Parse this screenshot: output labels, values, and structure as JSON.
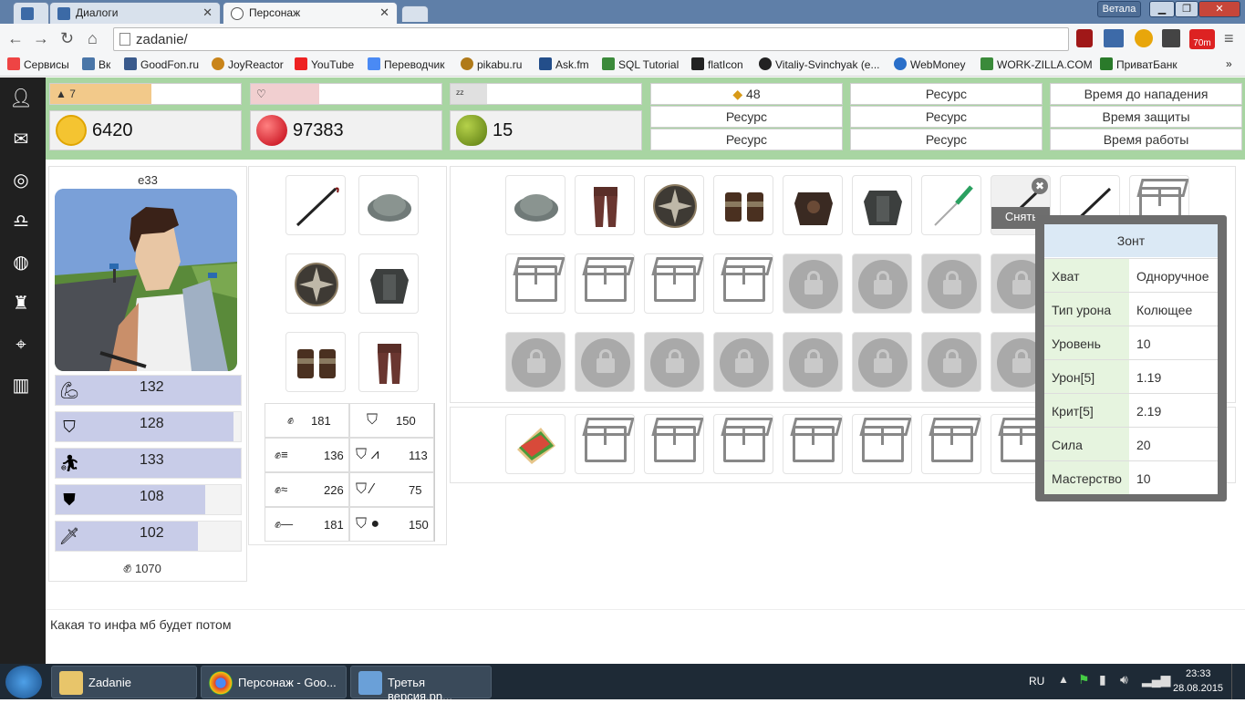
{
  "browser": {
    "tabs": [
      {
        "label": ""
      },
      {
        "label": "Диалоги"
      },
      {
        "label": "Персонаж"
      }
    ],
    "user_badge": "Ветала",
    "url": "zadanie/",
    "bookmarks": [
      "Сервисы",
      "Вк",
      "GoodFon.ru",
      "JoyReactor",
      "YouTube",
      "Переводчик",
      "pikabu.ru",
      "Ask.fm",
      "SQL Tutorial",
      "flatIcon",
      "Vitaliy-Svinchyak (e...",
      "WebMoney",
      "WORK-ZILLA.COM",
      "ПриватБанк"
    ],
    "ext_badge": "70m"
  },
  "status": {
    "level": "7",
    "level_pct": 0.53,
    "health_pct": 0.36,
    "sleep_pct": 0.19,
    "gold": "6420",
    "rubies": "97383",
    "olives": "15"
  },
  "resources": {
    "col1": [
      "48",
      "Ресурс",
      "Ресурс"
    ],
    "col2": [
      "Ресурс",
      "Ресурс",
      "Ресурс"
    ],
    "col3": [
      "Время до нападения",
      "Время защиты",
      "Время работы"
    ]
  },
  "character": {
    "name": "e33",
    "stats": [
      {
        "icon": "strength-icon",
        "value": "132",
        "pct": 1.0
      },
      {
        "icon": "defense-icon",
        "value": "128",
        "pct": 0.96
      },
      {
        "icon": "agility-icon",
        "value": "133",
        "pct": 1.0
      },
      {
        "icon": "armor-icon",
        "value": "108",
        "pct": 0.81
      },
      {
        "icon": "sword-icon",
        "value": "102",
        "pct": 0.77
      }
    ],
    "power": "1070"
  },
  "combat": {
    "attack": [
      "181",
      "136",
      "226",
      "181"
    ],
    "defense": [
      "150",
      "113",
      "75",
      "150"
    ]
  },
  "tooltip": {
    "title": "Зонт",
    "unequip": "Снять",
    "rows": [
      {
        "k": "Хват",
        "v": "Одноручное"
      },
      {
        "k": "Тип урона",
        "v": "Колющее"
      },
      {
        "k": "Уровень",
        "v": "10"
      },
      {
        "k": "Урон[5]",
        "v": "1.19"
      },
      {
        "k": "Крит[5]",
        "v": "2.19"
      },
      {
        "k": "Сила",
        "v": "20"
      },
      {
        "k": "Мастерство",
        "v": "10"
      }
    ]
  },
  "footer": {
    "info": "Какая то инфа мб будет потом"
  },
  "taskbar": {
    "items": [
      "Zadanie",
      "Персонаж - Goo...",
      "Третья версия.pn..."
    ],
    "lang": "RU",
    "time": "23:33",
    "date": "28.08.2015"
  },
  "colors": {
    "panel": "#a8d5a2",
    "bar_fill": "#c8cce8",
    "level_fill": "#f2c98a",
    "health_fill": "#f1cfd0"
  }
}
